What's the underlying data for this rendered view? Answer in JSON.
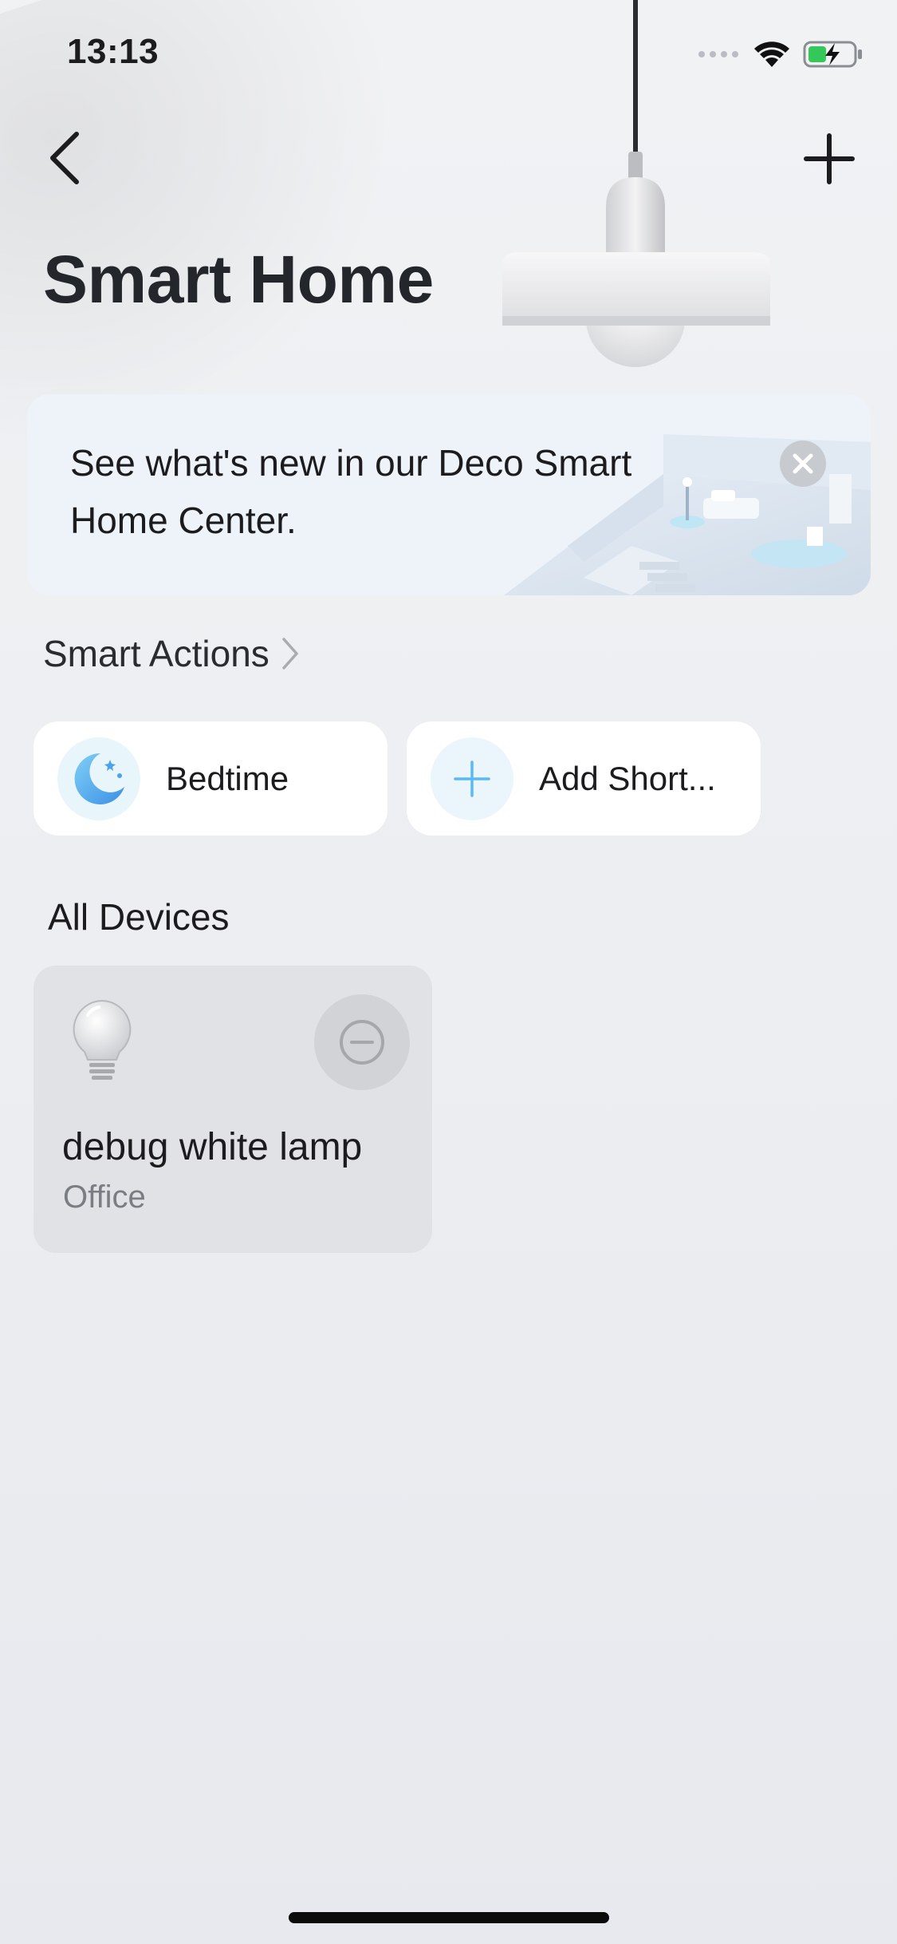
{
  "status_bar": {
    "time": "13:13"
  },
  "nav": {
    "back_icon": "chevron-left-icon",
    "add_icon": "plus-icon"
  },
  "page": {
    "title": "Smart Home"
  },
  "banner": {
    "text": "See what's new in our Deco Smart Home Center.",
    "close_icon": "close-icon"
  },
  "smart_actions": {
    "title": "Smart Actions",
    "items": [
      {
        "label": "Bedtime",
        "icon": "moon-icon"
      },
      {
        "label": "Add Short...",
        "icon": "plus-icon"
      }
    ]
  },
  "devices": {
    "title": "All Devices",
    "items": [
      {
        "name": "debug white lamp",
        "room": "Office",
        "icon": "bulb-icon",
        "action_icon": "remove-icon"
      }
    ]
  },
  "colors": {
    "accent": "#5bb8f0",
    "background": "#eceef1",
    "card": "#ffffff",
    "device_card": "#e1e2e5"
  }
}
